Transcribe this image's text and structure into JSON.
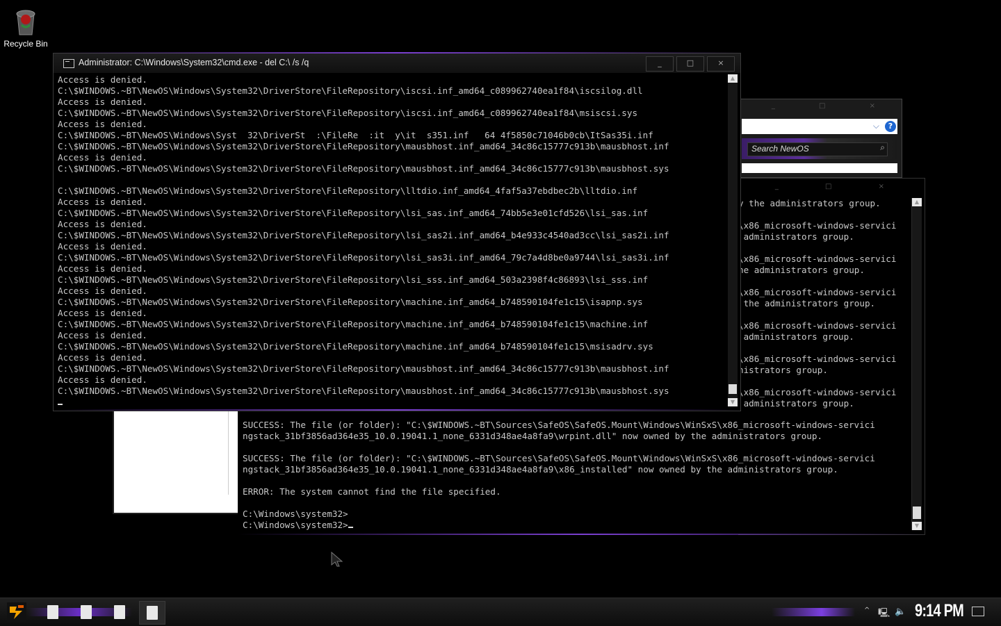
{
  "desktop": {
    "recycle_bin_label": "Recycle Bin"
  },
  "explorer": {
    "search_placeholder": "Search NewOS"
  },
  "cmd_main": {
    "title": "Administrator: C:\\Windows\\System32\\cmd.exe - del  C:\\ /s /q",
    "minimize": "_",
    "maximize": "□",
    "close": "×",
    "lines": [
      "Access is denied.",
      "C:\\$WINDOWS.~BT\\NewOS\\Windows\\System32\\DriverStore\\FileRepository\\iscsi.inf_amd64_c089962740ea1f84\\iscsilog.dll",
      "Access is denied.",
      "C:\\$WINDOWS.~BT\\NewOS\\Windows\\System32\\DriverStore\\FileRepository\\iscsi.inf_amd64_c089962740ea1f84\\msiscsi.sys",
      "Access is denied.",
      "C:\\$WINDOWS.~BT\\NewOS\\Windows\\Syst  32\\DriverSt  :\\FileRe  :it  y\\it  s351.inf   64 4f5850c71046b0cb\\ItSas35i.inf",
      "C:\\$WINDOWS.~BT\\NewOS\\Windows\\System32\\DriverStore\\FileRepository\\mausbhost.inf_amd64_34c86c15777c913b\\mausbhost.inf",
      "Access is denied.",
      "C:\\$WINDOWS.~BT\\NewOS\\Windows\\System32\\DriverStore\\FileRepository\\mausbhost.inf_amd64_34c86c15777c913b\\mausbhost.sys",
      "",
      "C:\\$WINDOWS.~BT\\NewOS\\Windows\\System32\\DriverStore\\FileRepository\\lltdio.inf_amd64_4faf5a37ebdbec2b\\lltdio.inf",
      "Access is denied.",
      "C:\\$WINDOWS.~BT\\NewOS\\Windows\\System32\\DriverStore\\FileRepository\\lsi_sas.inf_amd64_74bb5e3e01cfd526\\lsi_sas.inf",
      "Access is denied.",
      "C:\\$WINDOWS.~BT\\NewOS\\Windows\\System32\\DriverStore\\FileRepository\\lsi_sas2i.inf_amd64_b4e933c4540ad3cc\\lsi_sas2i.inf",
      "Access is denied.",
      "C:\\$WINDOWS.~BT\\NewOS\\Windows\\System32\\DriverStore\\FileRepository\\lsi_sas3i.inf_amd64_79c7a4d8be0a9744\\lsi_sas3i.inf",
      "Access is denied.",
      "C:\\$WINDOWS.~BT\\NewOS\\Windows\\System32\\DriverStore\\FileRepository\\lsi_sss.inf_amd64_503a2398f4c86893\\lsi_sss.inf",
      "Access is denied.",
      "C:\\$WINDOWS.~BT\\NewOS\\Windows\\System32\\DriverStore\\FileRepository\\machine.inf_amd64_b748590104fe1c15\\isapnp.sys",
      "Access is denied.",
      "C:\\$WINDOWS.~BT\\NewOS\\Windows\\System32\\DriverStore\\FileRepository\\machine.inf_amd64_b748590104fe1c15\\machine.inf",
      "Access is denied.",
      "C:\\$WINDOWS.~BT\\NewOS\\Windows\\System32\\DriverStore\\FileRepository\\machine.inf_amd64_b748590104fe1c15\\msisadrv.sys",
      "Access is denied.",
      "C:\\$WINDOWS.~BT\\NewOS\\Windows\\System32\\DriverStore\\FileRepository\\mausbhost.inf_amd64_34c86c15777c913b\\mausbhost.inf",
      "Access is denied.",
      "C:\\$WINDOWS.~BT\\NewOS\\Windows\\System32\\DriverStore\\FileRepository\\mausbhost.inf_amd64_34c86c15777c913b\\mausbhost.sys"
    ]
  },
  "cmd_back": {
    "right_lines": [
      "y the administrators group.",
      "",
      "\\x86_microsoft-windows-servici",
      " administrators group.",
      "",
      "\\x86_microsoft-windows-servici",
      "he administrators group.",
      "",
      "\\x86_microsoft-windows-servici",
      " the administrators group.",
      "",
      "\\x86_microsoft-windows-servici",
      " administrators group.",
      "",
      "\\x86_microsoft-windows-servici",
      "nistrators group.",
      "",
      "\\x86_microsoft-windows-servici",
      " administrators group."
    ],
    "lower_lines": [
      "SUCCESS: The file (or folder): \"C:\\$WINDOWS.~BT\\Sources\\SafeOS\\SafeOS.Mount\\Windows\\WinSxS\\x86_microsoft-windows-servici",
      "ngstack_31bf3856ad364e35_10.0.19041.1_none_6331d348ae4a8fa9\\wrpint.dll\" now owned by the administrators group.",
      "",
      "SUCCESS: The file (or folder): \"C:\\$WINDOWS.~BT\\Sources\\SafeOS\\SafeOS.Mount\\Windows\\WinSxS\\x86_microsoft-windows-servici",
      "ngstack_31bf3856ad364e35_10.0.19041.1_none_6331d348ae4a8fa9\\x86_installed\" now owned by the administrators group.",
      "",
      "ERROR: The system cannot find the file specified.",
      "",
      "C:\\Windows\\system32>",
      "C:\\Windows\\system32>"
    ]
  },
  "taskbar": {
    "clock": "9:14 PM"
  },
  "colors": {
    "accent_purple": "#7a3fd0",
    "console_text": "#c8c8c8"
  }
}
